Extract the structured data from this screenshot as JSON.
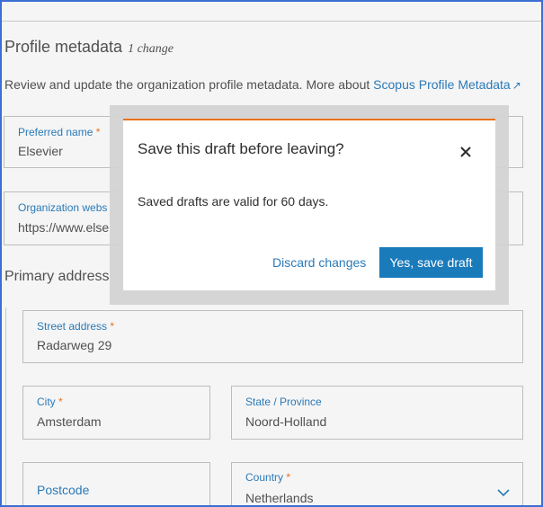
{
  "header": {
    "title": "Profile metadata",
    "change_count": "1 change",
    "description": "Review and update the organization profile metadata. More about ",
    "link_text": "Scopus Profile Metadata"
  },
  "fields": {
    "preferred_name": {
      "label": "Preferred name",
      "required": "*",
      "value": "Elsevier"
    },
    "website": {
      "label": "Organization webs",
      "value": "https://www.else"
    }
  },
  "primary_address": {
    "title": "Primary address",
    "street": {
      "label": "Street address",
      "required": "*",
      "value": "Radarweg 29"
    },
    "city": {
      "label": "City",
      "required": "*",
      "value": "Amsterdam"
    },
    "state": {
      "label": "State / Province",
      "value": "Noord-Holland"
    },
    "postcode": {
      "label": "Postcode"
    },
    "country": {
      "label": "Country",
      "required": "*",
      "value": "Netherlands"
    }
  },
  "dialog": {
    "title": "Save this draft before leaving?",
    "body": "Saved drafts are valid for 60 days.",
    "discard_label": "Discard changes",
    "save_label": "Yes, save draft",
    "close_icon": "close-icon"
  },
  "colors": {
    "accent_orange": "#e9711c",
    "link_blue": "#2a7ab8",
    "button_blue": "#1a7bbb"
  }
}
